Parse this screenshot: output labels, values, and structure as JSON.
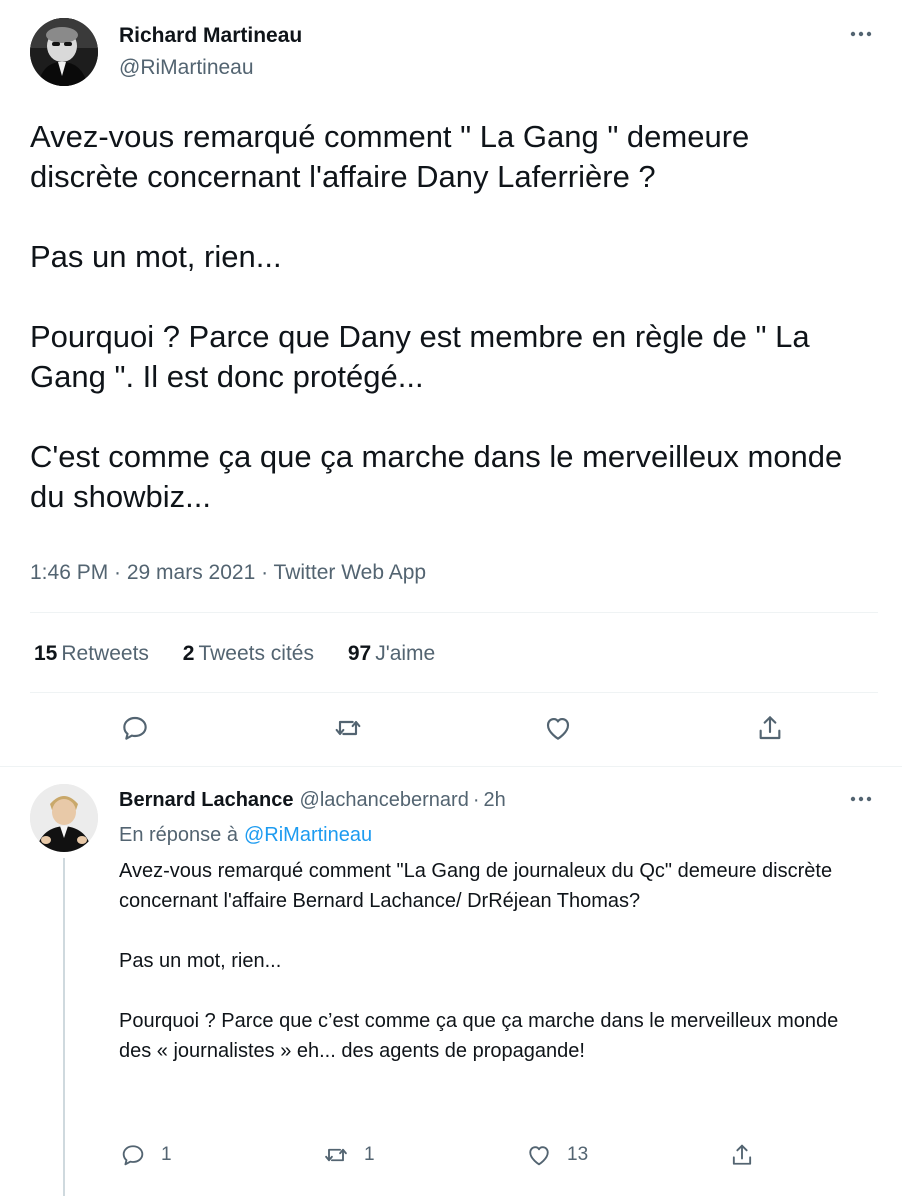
{
  "main_tweet": {
    "author_name": "Richard Martineau",
    "author_handle": "@RiMartineau",
    "paragraphs": [
      "Avez-vous remarqué comment \" La Gang \" demeure discrète concernant l'affaire Dany Laferrière ?",
      "Pas un mot, rien...",
      "Pourquoi ? Parce que Dany est membre en règle de \" La Gang \". Il est donc protégé...",
      "C'est comme ça que ça marche dans le merveilleux monde du showbiz..."
    ],
    "meta": "1:46 PM · 29 mars 2021 · Twitter Web App",
    "stats": {
      "retweets_count": "15",
      "retweets_label": "Retweets",
      "quotes_count": "2",
      "quotes_label": "Tweets cités",
      "likes_count": "97",
      "likes_label": "J'aime"
    },
    "icons": {
      "more": "more-horizontal-icon",
      "reply": "reply-bubble-icon",
      "retweet": "retweet-icon",
      "like": "heart-icon",
      "share": "share-icon"
    }
  },
  "reply_tweet": {
    "author_name": "Bernard Lachance",
    "author_handle": "@lachancebernard",
    "separator": "·",
    "time": "2h",
    "replying_label": "En réponse à",
    "replying_handle": "@RiMartineau",
    "paragraphs": [
      "Avez-vous remarqué comment \"La Gang de journaleux du Qc\" demeure discrète concernant l'affaire Bernard Lachance/ DrRéjean Thomas?",
      "Pas un mot, rien...",
      "Pourquoi ? Parce que c’est comme ça que ça marche dans le merveilleux monde des « journalistes » eh... des agents de propagande!"
    ],
    "actions": {
      "reply_count": "1",
      "retweet_count": "1",
      "like_count": "13"
    }
  },
  "colors": {
    "text_primary": "#0f1419",
    "text_secondary": "#536471",
    "link": "#1d9bf0",
    "divider": "#eff3f4",
    "thread_line": "#cfd9de"
  }
}
